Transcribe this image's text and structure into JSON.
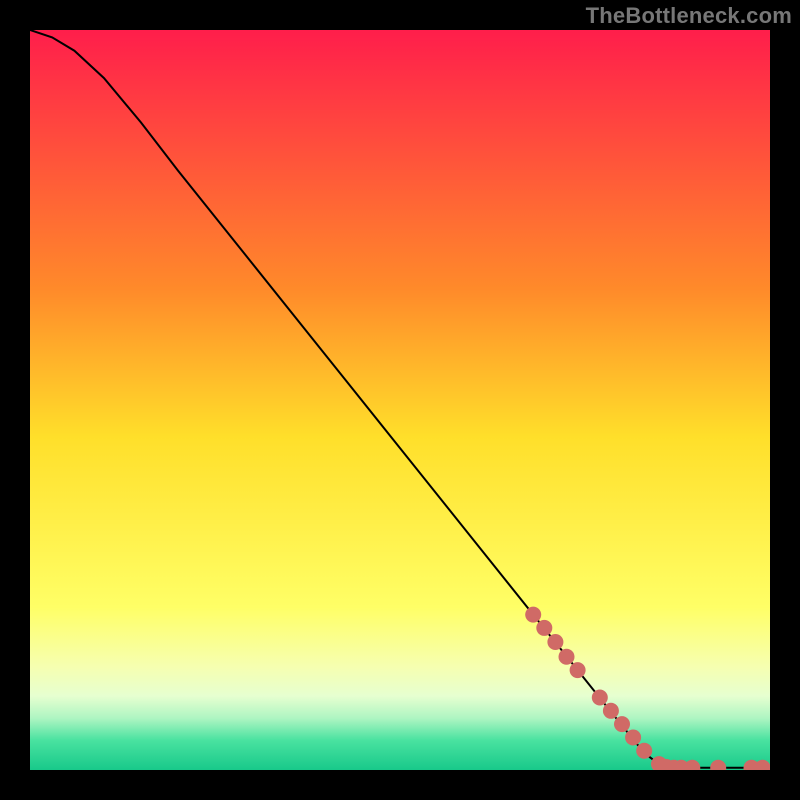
{
  "watermark": "TheBottleneck.com",
  "chart_data": {
    "type": "line",
    "title": "",
    "xlabel": "",
    "ylabel": "",
    "xlim": [
      0,
      100
    ],
    "ylim": [
      0,
      100
    ],
    "grid": false,
    "legend": false,
    "gradient_stops": [
      {
        "offset": 0.0,
        "color": "#ff1e4b"
      },
      {
        "offset": 0.35,
        "color": "#ff8a2a"
      },
      {
        "offset": 0.55,
        "color": "#ffdf2a"
      },
      {
        "offset": 0.78,
        "color": "#ffff66"
      },
      {
        "offset": 0.86,
        "color": "#f6ffb0"
      },
      {
        "offset": 0.9,
        "color": "#e6ffd0"
      },
      {
        "offset": 0.93,
        "color": "#aef5c2"
      },
      {
        "offset": 0.96,
        "color": "#49e2a0"
      },
      {
        "offset": 1.0,
        "color": "#18c98a"
      }
    ],
    "series": [
      {
        "name": "curve",
        "type": "line",
        "color": "#000000",
        "stroke_width": 2,
        "points": [
          {
            "x": 0.0,
            "y": 100.0
          },
          {
            "x": 3.0,
            "y": 99.0
          },
          {
            "x": 6.0,
            "y": 97.2
          },
          {
            "x": 10.0,
            "y": 93.5
          },
          {
            "x": 15.0,
            "y": 87.5
          },
          {
            "x": 20.0,
            "y": 81.0
          },
          {
            "x": 30.0,
            "y": 68.5
          },
          {
            "x": 40.0,
            "y": 56.0
          },
          {
            "x": 50.0,
            "y": 43.5
          },
          {
            "x": 60.0,
            "y": 31.0
          },
          {
            "x": 70.0,
            "y": 18.5
          },
          {
            "x": 78.0,
            "y": 8.5
          },
          {
            "x": 83.0,
            "y": 2.3
          },
          {
            "x": 85.0,
            "y": 0.8
          },
          {
            "x": 87.0,
            "y": 0.3
          },
          {
            "x": 90.0,
            "y": 0.3
          },
          {
            "x": 100.0,
            "y": 0.3
          }
        ]
      },
      {
        "name": "markers",
        "type": "scatter",
        "color": "#d06a66",
        "radius": 8,
        "points": [
          {
            "x": 68.0,
            "y": 21.0
          },
          {
            "x": 69.5,
            "y": 19.2
          },
          {
            "x": 71.0,
            "y": 17.3
          },
          {
            "x": 72.5,
            "y": 15.3
          },
          {
            "x": 74.0,
            "y": 13.5
          },
          {
            "x": 77.0,
            "y": 9.8
          },
          {
            "x": 78.5,
            "y": 8.0
          },
          {
            "x": 80.0,
            "y": 6.2
          },
          {
            "x": 81.5,
            "y": 4.4
          },
          {
            "x": 83.0,
            "y": 2.6
          },
          {
            "x": 85.0,
            "y": 0.8
          },
          {
            "x": 86.0,
            "y": 0.4
          },
          {
            "x": 87.0,
            "y": 0.3
          },
          {
            "x": 88.0,
            "y": 0.3
          },
          {
            "x": 89.5,
            "y": 0.3
          },
          {
            "x": 93.0,
            "y": 0.3
          },
          {
            "x": 97.5,
            "y": 0.3
          },
          {
            "x": 99.0,
            "y": 0.3
          }
        ]
      }
    ]
  }
}
